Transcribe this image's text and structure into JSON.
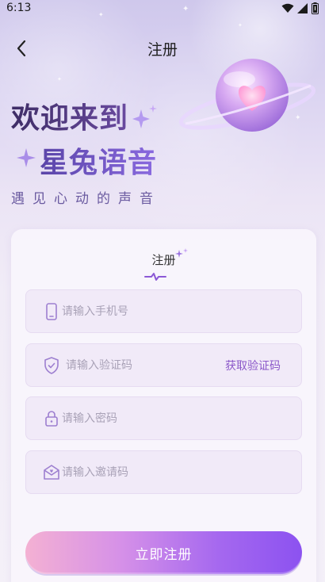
{
  "status_bar": {
    "time": "6:13",
    "icons": [
      "wifi-icon",
      "cellular-signal-icon",
      "battery-icon"
    ]
  },
  "header": {
    "title": "注册",
    "back_icon": "chevron-left-icon"
  },
  "hero": {
    "line1": "欢迎来到",
    "line2": "星兔语音",
    "slogan": "遇见心动的声音",
    "illustration": "heart-planet-icon"
  },
  "form": {
    "tab_title": "注册",
    "fields": {
      "phone": {
        "placeholder": "请输入手机号",
        "value": "",
        "icon": "phone-icon"
      },
      "code": {
        "placeholder": "请输入验证码",
        "value": "",
        "icon": "shield-check-icon",
        "action_label": "获取验证码"
      },
      "password": {
        "placeholder": "请输入密码",
        "value": "",
        "icon": "lock-icon"
      },
      "invite": {
        "placeholder": "请输入邀请码",
        "value": "",
        "icon": "mail-heart-icon"
      }
    },
    "submit_label": "立即注册"
  },
  "colors": {
    "accent": "#8b58c9",
    "title_dark": "#4a3575",
    "button_start": "#f4b1d3",
    "button_end": "#8c52f0"
  }
}
